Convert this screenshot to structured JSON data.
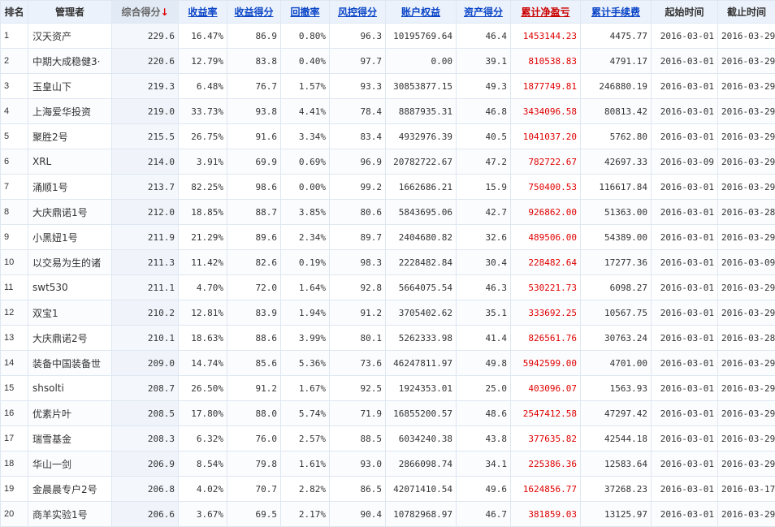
{
  "headers": {
    "rank": "排名",
    "manager": "管理者",
    "composite": "综合得分",
    "sort_arrow": "↓",
    "return_rate": "收益率",
    "return_score": "收益得分",
    "drawdown": "回撤率",
    "risk_score": "风控得分",
    "equity": "账户权益",
    "asset_score": "资产得分",
    "cum_pnl": "累计净盈亏",
    "cum_fee": "累计手续费",
    "start": "起始时间",
    "end": "截止时间"
  },
  "rows": [
    {
      "rank": "1",
      "name": "汉天资产",
      "composite": "229.6",
      "return_rate": "16.47%",
      "return_score": "86.9",
      "drawdown": "0.80%",
      "risk_score": "96.3",
      "equity": "10195769.64",
      "asset_score": "46.4",
      "cum_pnl": "1453144.23",
      "cum_fee": "4475.77",
      "start": "2016-03-01",
      "end": "2016-03-29"
    },
    {
      "rank": "2",
      "name": "中期大成稳健3·",
      "composite": "220.6",
      "return_rate": "12.79%",
      "return_score": "83.8",
      "drawdown": "0.40%",
      "risk_score": "97.7",
      "equity": "0.00",
      "asset_score": "39.1",
      "cum_pnl": "810538.83",
      "cum_fee": "4791.17",
      "start": "2016-03-01",
      "end": "2016-03-29"
    },
    {
      "rank": "3",
      "name": "玉皇山下",
      "composite": "219.3",
      "return_rate": "6.48%",
      "return_score": "76.7",
      "drawdown": "1.57%",
      "risk_score": "93.3",
      "equity": "30853877.15",
      "asset_score": "49.3",
      "cum_pnl": "1877749.81",
      "cum_fee": "246880.19",
      "start": "2016-03-01",
      "end": "2016-03-29"
    },
    {
      "rank": "4",
      "name": "上海爱华投资",
      "composite": "219.0",
      "return_rate": "33.73%",
      "return_score": "93.8",
      "drawdown": "4.41%",
      "risk_score": "78.4",
      "equity": "8887935.31",
      "asset_score": "46.8",
      "cum_pnl": "3434096.58",
      "cum_fee": "80813.42",
      "start": "2016-03-01",
      "end": "2016-03-29"
    },
    {
      "rank": "5",
      "name": "聚胜2号",
      "composite": "215.5",
      "return_rate": "26.75%",
      "return_score": "91.6",
      "drawdown": "3.34%",
      "risk_score": "83.4",
      "equity": "4932976.39",
      "asset_score": "40.5",
      "cum_pnl": "1041037.20",
      "cum_fee": "5762.80",
      "start": "2016-03-01",
      "end": "2016-03-29"
    },
    {
      "rank": "6",
      "name": "XRL",
      "composite": "214.0",
      "return_rate": "3.91%",
      "return_score": "69.9",
      "drawdown": "0.69%",
      "risk_score": "96.9",
      "equity": "20782722.67",
      "asset_score": "47.2",
      "cum_pnl": "782722.67",
      "cum_fee": "42697.33",
      "start": "2016-03-09",
      "end": "2016-03-29"
    },
    {
      "rank": "7",
      "name": "涌顺1号",
      "composite": "213.7",
      "return_rate": "82.25%",
      "return_score": "98.6",
      "drawdown": "0.00%",
      "risk_score": "99.2",
      "equity": "1662686.21",
      "asset_score": "15.9",
      "cum_pnl": "750400.53",
      "cum_fee": "116617.84",
      "start": "2016-03-01",
      "end": "2016-03-29"
    },
    {
      "rank": "8",
      "name": "大庆鼎诺1号",
      "composite": "212.0",
      "return_rate": "18.85%",
      "return_score": "88.7",
      "drawdown": "3.85%",
      "risk_score": "80.6",
      "equity": "5843695.06",
      "asset_score": "42.7",
      "cum_pnl": "926862.00",
      "cum_fee": "51363.00",
      "start": "2016-03-01",
      "end": "2016-03-28"
    },
    {
      "rank": "9",
      "name": "小黑妞1号",
      "composite": "211.9",
      "return_rate": "21.29%",
      "return_score": "89.6",
      "drawdown": "2.34%",
      "risk_score": "89.7",
      "equity": "2404680.82",
      "asset_score": "32.6",
      "cum_pnl": "489506.00",
      "cum_fee": "54389.00",
      "start": "2016-03-01",
      "end": "2016-03-29"
    },
    {
      "rank": "10",
      "name": "以交易为生的诸",
      "composite": "211.3",
      "return_rate": "11.42%",
      "return_score": "82.6",
      "drawdown": "0.19%",
      "risk_score": "98.3",
      "equity": "2228482.84",
      "asset_score": "30.4",
      "cum_pnl": "228482.64",
      "cum_fee": "17277.36",
      "start": "2016-03-01",
      "end": "2016-03-09"
    },
    {
      "rank": "11",
      "name": "swt530",
      "composite": "211.1",
      "return_rate": "4.70%",
      "return_score": "72.0",
      "drawdown": "1.64%",
      "risk_score": "92.8",
      "equity": "5664075.54",
      "asset_score": "46.3",
      "cum_pnl": "530221.73",
      "cum_fee": "6098.27",
      "start": "2016-03-01",
      "end": "2016-03-29"
    },
    {
      "rank": "12",
      "name": "双宝1",
      "composite": "210.2",
      "return_rate": "12.81%",
      "return_score": "83.9",
      "drawdown": "1.94%",
      "risk_score": "91.2",
      "equity": "3705402.62",
      "asset_score": "35.1",
      "cum_pnl": "333692.25",
      "cum_fee": "10567.75",
      "start": "2016-03-01",
      "end": "2016-03-29"
    },
    {
      "rank": "13",
      "name": "大庆鼎诺2号",
      "composite": "210.1",
      "return_rate": "18.63%",
      "return_score": "88.6",
      "drawdown": "3.99%",
      "risk_score": "80.1",
      "equity": "5262333.98",
      "asset_score": "41.4",
      "cum_pnl": "826561.76",
      "cum_fee": "30763.24",
      "start": "2016-03-01",
      "end": "2016-03-28"
    },
    {
      "rank": "14",
      "name": "装备中国装备世",
      "composite": "209.0",
      "return_rate": "14.74%",
      "return_score": "85.6",
      "drawdown": "5.36%",
      "risk_score": "73.6",
      "equity": "46247811.97",
      "asset_score": "49.8",
      "cum_pnl": "5942599.00",
      "cum_fee": "4701.00",
      "start": "2016-03-01",
      "end": "2016-03-29"
    },
    {
      "rank": "15",
      "name": "shsolti",
      "composite": "208.7",
      "return_rate": "26.50%",
      "return_score": "91.2",
      "drawdown": "1.67%",
      "risk_score": "92.5",
      "equity": "1924353.01",
      "asset_score": "25.0",
      "cum_pnl": "403096.07",
      "cum_fee": "1563.93",
      "start": "2016-03-01",
      "end": "2016-03-29"
    },
    {
      "rank": "16",
      "name": "优素片叶",
      "composite": "208.5",
      "return_rate": "17.80%",
      "return_score": "88.0",
      "drawdown": "5.74%",
      "risk_score": "71.9",
      "equity": "16855200.57",
      "asset_score": "48.6",
      "cum_pnl": "2547412.58",
      "cum_fee": "47297.42",
      "start": "2016-03-01",
      "end": "2016-03-29"
    },
    {
      "rank": "17",
      "name": "瑞雪基金",
      "composite": "208.3",
      "return_rate": "6.32%",
      "return_score": "76.0",
      "drawdown": "2.57%",
      "risk_score": "88.5",
      "equity": "6034240.38",
      "asset_score": "43.8",
      "cum_pnl": "377635.82",
      "cum_fee": "42544.18",
      "start": "2016-03-01",
      "end": "2016-03-29"
    },
    {
      "rank": "18",
      "name": "华山一剑",
      "composite": "206.9",
      "return_rate": "8.54%",
      "return_score": "79.8",
      "drawdown": "1.61%",
      "risk_score": "93.0",
      "equity": "2866098.74",
      "asset_score": "34.1",
      "cum_pnl": "225386.36",
      "cum_fee": "12583.64",
      "start": "2016-03-01",
      "end": "2016-03-29"
    },
    {
      "rank": "19",
      "name": "金晨晨专户2号",
      "composite": "206.8",
      "return_rate": "4.02%",
      "return_score": "70.7",
      "drawdown": "2.82%",
      "risk_score": "86.5",
      "equity": "42071410.54",
      "asset_score": "49.6",
      "cum_pnl": "1624856.77",
      "cum_fee": "37268.23",
      "start": "2016-03-01",
      "end": "2016-03-17"
    },
    {
      "rank": "20",
      "name": "商羊实验1号",
      "composite": "206.6",
      "return_rate": "3.67%",
      "return_score": "69.5",
      "drawdown": "2.17%",
      "risk_score": "90.4",
      "equity": "10782968.97",
      "asset_score": "46.7",
      "cum_pnl": "381859.03",
      "cum_fee": "13125.97",
      "start": "2016-03-01",
      "end": "2016-03-29"
    }
  ]
}
